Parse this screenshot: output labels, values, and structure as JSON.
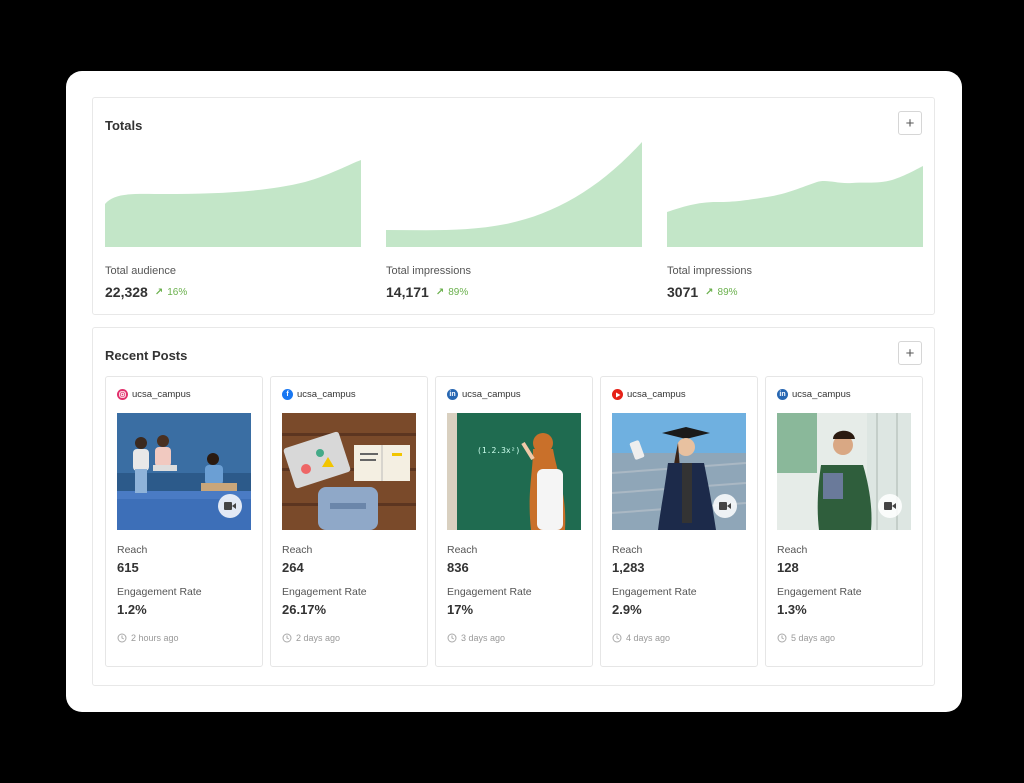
{
  "totals": {
    "title": "Totals",
    "add_label": "+",
    "metrics": [
      {
        "label": "Total audience",
        "value": "22,328",
        "trend": "16%"
      },
      {
        "label": "Total impressions",
        "value": "14,171",
        "trend": "89%"
      },
      {
        "label": "Total impressions",
        "value": "3071",
        "trend": "89%"
      }
    ]
  },
  "posts": {
    "title": "Recent Posts",
    "add_label": "+",
    "reach_label": "Reach",
    "engagement_label": "Engagement Rate",
    "items": [
      {
        "network": "instagram-icon",
        "handle": "ucsa_campus",
        "reach": "615",
        "engagement": "1.2%",
        "time": "2 hours ago",
        "video": true
      },
      {
        "network": "facebook-icon",
        "handle": "ucsa_campus",
        "reach": "264",
        "engagement": "26.17%",
        "time": "2 days ago",
        "video": false
      },
      {
        "network": "linkedin-icon",
        "handle": "ucsa_campus",
        "reach": "836",
        "engagement": "17%",
        "time": "3 days ago",
        "video": false
      },
      {
        "network": "youtube-icon",
        "handle": "ucsa_campus",
        "reach": "1,283",
        "engagement": "2.9%",
        "time": "4 days ago",
        "video": true
      },
      {
        "network": "linkedin-icon",
        "handle": "ucsa_campus",
        "reach": "128",
        "engagement": "1.3%",
        "time": "5 days ago",
        "video": true
      }
    ]
  },
  "colors": {
    "chart_fill": "#c3e6c8",
    "trend_green": "#6ab04c",
    "instagram": "#e1306c",
    "facebook": "#1877f2",
    "linkedin": "#2867b2",
    "youtube": "#e62117"
  }
}
